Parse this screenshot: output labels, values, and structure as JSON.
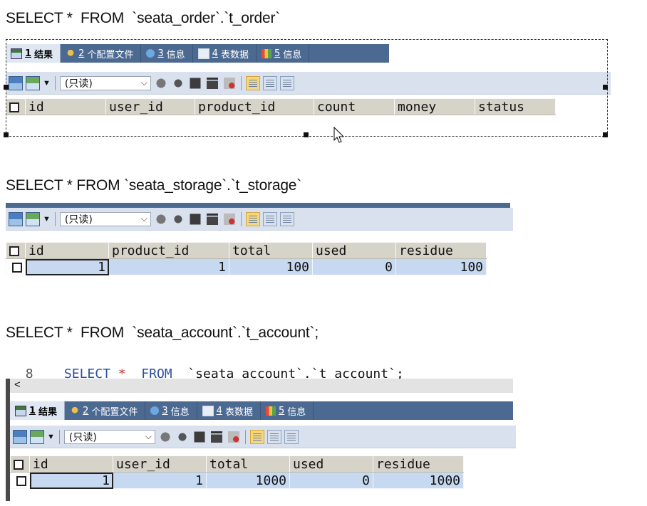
{
  "queries": {
    "order_caption": "SELECT *  FROM  `seata_order`.`t_order`",
    "storage_caption": "SELECT * FROM `seata_storage`.`t_storage`",
    "account_caption": "SELECT *  FROM  `seata_account`.`t_account`;"
  },
  "tabs": [
    {
      "num": "1",
      "label": "结果",
      "icon": "grid-result-icon"
    },
    {
      "num": "2",
      "label": "个配置文件",
      "icon": "profile-icon"
    },
    {
      "num": "3",
      "label": "信息",
      "icon": "info-icon"
    },
    {
      "num": "4",
      "label": "表数据",
      "icon": "table-data-icon"
    },
    {
      "num": "5",
      "label": "信息",
      "icon": "info-history-icon"
    }
  ],
  "toolbar": {
    "mode_value": "(只读)",
    "icons": [
      "export-icon",
      "import-icon",
      "refresh-icon",
      "copy-icon",
      "save-icon",
      "delete-icon",
      "cancel-icon",
      "grid-view-icon",
      "form-view-icon",
      "text-view-icon"
    ]
  },
  "order_grid": {
    "columns": [
      "id",
      "user_id",
      "product_id",
      "count",
      "money",
      "status"
    ],
    "rows": []
  },
  "storage_grid": {
    "columns": [
      "id",
      "product_id",
      "total",
      "used",
      "residue"
    ],
    "rows": [
      [
        "1",
        "1",
        "100",
        "0",
        "100"
      ]
    ]
  },
  "editor": {
    "line_number": "8",
    "code_keyword1": "SELECT",
    "code_star": "*",
    "code_keyword2": "FROM",
    "code_rest": "`seata_account`.`t_account`;",
    "scroll_arrow": "<"
  },
  "account_grid": {
    "columns": [
      "id",
      "user_id",
      "total",
      "used",
      "residue"
    ],
    "rows": [
      [
        "1",
        "1",
        "1000",
        "0",
        "1000"
      ]
    ]
  },
  "colors": {
    "tab_bar": "#4c6991",
    "toolbar_bg": "#d8e1ed",
    "header_bg": "#d6d3c9",
    "cell_bg": "#c6d9f1",
    "keyword": "#2b4f9e"
  }
}
